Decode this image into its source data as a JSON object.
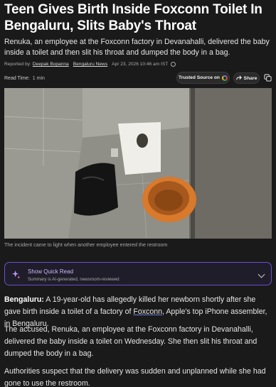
{
  "article": {
    "headline": "Teen Gives Birth Inside Foxconn Toilet In Bengaluru, Slits Baby's Throat",
    "summary": "Renuka, an employee at the Foxconn factory in Devanahalli, delivered the baby inside a toilet and then slit his throat and dumped the body in a bag.",
    "reported_by_label": "Reported by:",
    "author": "Deepak Bopanna",
    "outlet": "Bengaluru News",
    "datetime": "Apr 23, 2026 10:46 am IST",
    "read_time_label": "Read Time:",
    "read_time_value": "1 min",
    "trusted_source_label": "Trusted Source on",
    "share_label": "Share",
    "image_caption": "The incident came to light when another employee entered the restroom"
  },
  "quick_read": {
    "title": "Show Quick Read",
    "subtitle": "Summary is AI-generated, newsroom-reviewed"
  },
  "body": {
    "p1_lead": "Bengaluru:",
    "p1_a": " A 19-year-old has allegedly killed her newborn shortly after she gave birth inside a toilet of a factory of ",
    "p1_entity": "Foxconn",
    "p1_b": ", Apple's top iPhone assembler, in Bengaluru.",
    "p2": "The accused, Renuka, an employee at the Foxconn factory in Devanahalli, delivered the baby inside a toilet on Wednesday. She then slit his throat and dumped the body in a bag.",
    "p3": "Authorities suspect that the delivery was sudden and unplanned while she had gone to use the restroom."
  },
  "colors": {
    "background": "#1a1a1a",
    "accent_purple": "#6b4fd0",
    "quick_read_text": "#c9b8ff"
  },
  "icons": [
    "clock-icon",
    "google-icon",
    "share-icon",
    "copy-icon",
    "sparkle-icon",
    "chevron-down-icon"
  ]
}
